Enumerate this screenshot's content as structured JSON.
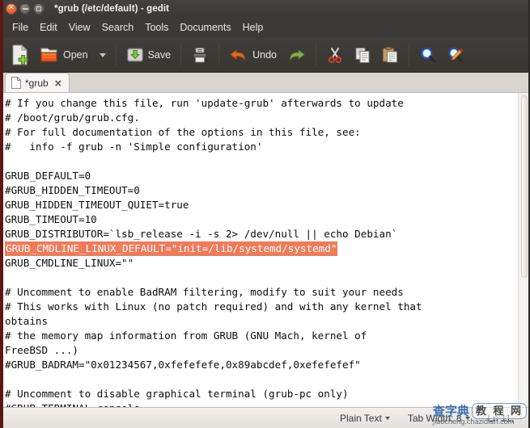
{
  "window": {
    "title": "*grub (/etc/default) - gedit",
    "controls": [
      {
        "name": "close",
        "glyph": "×"
      },
      {
        "name": "minimize",
        "glyph": "−"
      },
      {
        "name": "maximize",
        "glyph": "□"
      }
    ]
  },
  "menubar": {
    "items": [
      "File",
      "Edit",
      "View",
      "Search",
      "Tools",
      "Documents",
      "Help"
    ]
  },
  "toolbar": {
    "new_label": "",
    "open_label": "Open",
    "save_label": "Save",
    "print_label": "",
    "undo_label": "Undo",
    "redo_label": "",
    "cut_label": "",
    "copy_label": "",
    "paste_label": "",
    "find_label": "",
    "replace_label": "",
    "icons": [
      "new-document-icon",
      "open-folder-icon",
      "open-dropdown-caret-icon",
      "save-icon",
      "print-icon",
      "undo-icon",
      "redo-icon",
      "cut-scissors-icon",
      "copy-icon",
      "paste-icon",
      "find-magnifier-icon",
      "replace-magnifier-pencil-icon"
    ]
  },
  "tabs": [
    {
      "label": "*grub",
      "close": "×",
      "active": true
    }
  ],
  "editor": {
    "lines": [
      {
        "text": "# If you change this file, run 'update-grub' afterwards to update",
        "highlight": false
      },
      {
        "text": "# /boot/grub/grub.cfg.",
        "highlight": false
      },
      {
        "text": "# For full documentation of the options in this file, see:",
        "highlight": false
      },
      {
        "text": "#   info -f grub -n 'Simple configuration'",
        "highlight": false
      },
      {
        "text": "",
        "highlight": false
      },
      {
        "text": "GRUB_DEFAULT=0",
        "highlight": false
      },
      {
        "text": "#GRUB_HIDDEN_TIMEOUT=0",
        "highlight": false
      },
      {
        "text": "GRUB_HIDDEN_TIMEOUT_QUIET=true",
        "highlight": false
      },
      {
        "text": "GRUB_TIMEOUT=10",
        "highlight": false
      },
      {
        "text": "GRUB_DISTRIBUTOR=`lsb_release -i -s 2> /dev/null || echo Debian`",
        "highlight": false
      },
      {
        "text": "GRUB_CMDLINE_LINUX_DEFAULT=\"init=/lib/systemd/systemd\"",
        "highlight": true
      },
      {
        "text": "GRUB_CMDLINE_LINUX=\"\"",
        "highlight": false
      },
      {
        "text": "",
        "highlight": false
      },
      {
        "text": "# Uncomment to enable BadRAM filtering, modify to suit your needs",
        "highlight": false
      },
      {
        "text": "# This works with Linux (no patch required) and with any kernel that",
        "highlight": false
      },
      {
        "text": "obtains",
        "highlight": false
      },
      {
        "text": "# the memory map information from GRUB (GNU Mach, kernel of",
        "highlight": false
      },
      {
        "text": "FreeBSD ...)",
        "highlight": false
      },
      {
        "text": "#GRUB_BADRAM=\"0x01234567,0xfefefefe,0x89abcdef,0xefefefef\"",
        "highlight": false
      },
      {
        "text": "",
        "highlight": false
      },
      {
        "text": "# Uncomment to disable graphical terminal (grub-pc only)",
        "highlight": false
      },
      {
        "text": "#GRUB_TERMINAL=console",
        "highlight": false
      }
    ],
    "highlight_color": "#ef7b5b"
  },
  "statusbar": {
    "language": "Plain Text",
    "tab_width": "Tab Width: 8",
    "position": "Ln 11,"
  },
  "watermark": {
    "brand": "查字典",
    "brand_box": "教 程 网",
    "url": "jiaocheng.chazidian.com"
  }
}
